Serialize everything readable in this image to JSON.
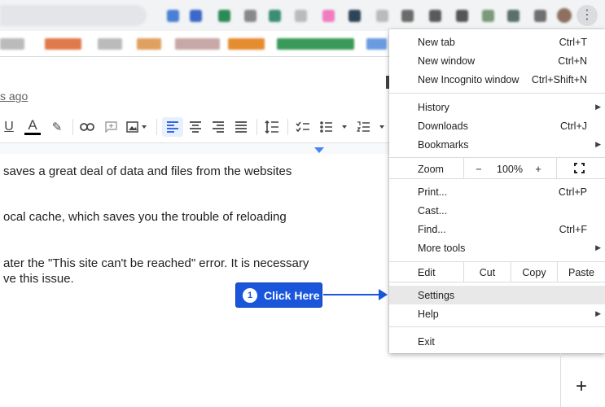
{
  "document": {
    "edited_text": "s ago",
    "paragraphs": [
      "saves a great deal of data and files from the websites",
      "ocal cache, which saves you the trouble of reloading",
      "ater the \"This site can't be reached\" error. It is necessary",
      "ve this issue."
    ]
  },
  "toolbar": {
    "underline": "U",
    "text_color": "A",
    "plus_label": "+"
  },
  "callout": {
    "number": "1",
    "label": "Click Here",
    "color": "#1a56db"
  },
  "menu": {
    "items": [
      {
        "label": "New tab",
        "shortcut": "Ctrl+T"
      },
      {
        "label": "New window",
        "shortcut": "Ctrl+N"
      },
      {
        "label": "New Incognito window",
        "shortcut": "Ctrl+Shift+N"
      },
      {
        "label": "History",
        "shortcut": ""
      },
      {
        "label": "Downloads",
        "shortcut": "Ctrl+J"
      },
      {
        "label": "Bookmarks",
        "shortcut": ""
      },
      {
        "label": "Print...",
        "shortcut": "Ctrl+P"
      },
      {
        "label": "Cast...",
        "shortcut": ""
      },
      {
        "label": "Find...",
        "shortcut": "Ctrl+F"
      },
      {
        "label": "More tools",
        "shortcut": ""
      },
      {
        "label": "Settings",
        "shortcut": ""
      },
      {
        "label": "Help",
        "shortcut": ""
      },
      {
        "label": "Exit",
        "shortcut": ""
      }
    ],
    "zoom": {
      "label": "Zoom",
      "minus": "−",
      "value": "100%",
      "plus": "+"
    },
    "edit": {
      "label": "Edit",
      "cut": "Cut",
      "copy": "Copy",
      "paste": "Paste"
    }
  },
  "colors": {
    "menu_highlight": "#e8e8e8",
    "toolbar_active": "#e8f0fe",
    "ruler_marker": "#4285f4"
  }
}
